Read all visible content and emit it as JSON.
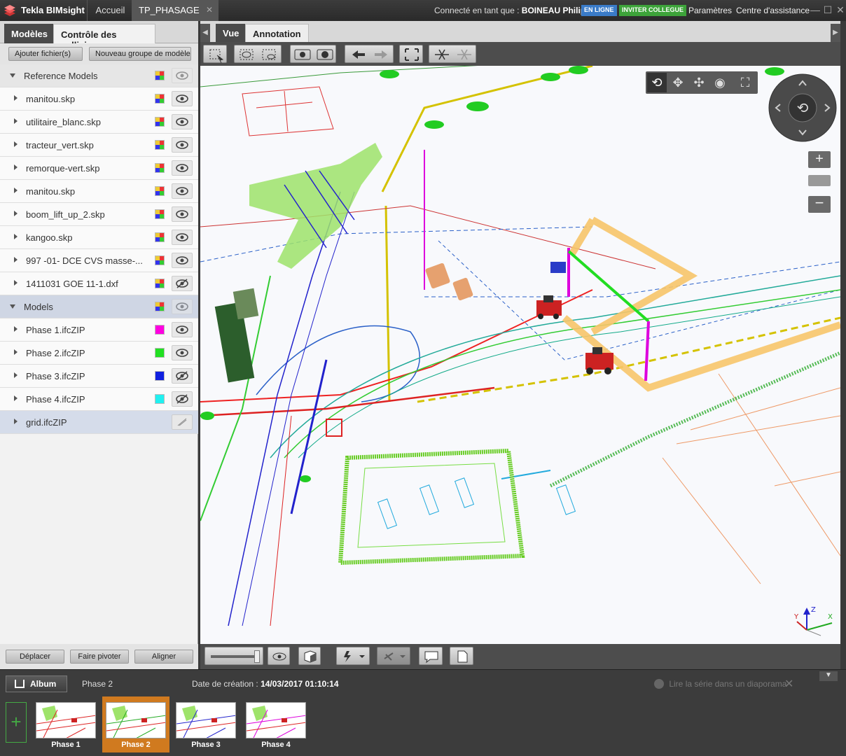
{
  "titlebar": {
    "app_name": "Tekla BIMsight",
    "tab_home": "Accueil",
    "tab_project": "TP_PHASAGE",
    "user_prefix": "Connecté en tant que :",
    "user_name": "BOINEAU Philippe",
    "status_badge": "EN LIGNE",
    "invite_button": "INVITER COLLEGUE",
    "settings_link": "Paramètres",
    "help_link": "Centre d'assistance"
  },
  "left_panel": {
    "tab_models": "Modèles",
    "tab_clashes": "Contrôle des collisions",
    "add_files": "Ajouter fichier(s)",
    "new_group": "Nouveau groupe de modèles",
    "groups": [
      {
        "label": "Reference Models",
        "items": [
          {
            "label": "manitou.skp",
            "color": "multi",
            "visible": true
          },
          {
            "label": "utilitaire_blanc.skp",
            "color": "multi",
            "visible": true
          },
          {
            "label": "tracteur_vert.skp",
            "color": "multi",
            "visible": true
          },
          {
            "label": "remorque-vert.skp",
            "color": "multi",
            "visible": true
          },
          {
            "label": "manitou.skp",
            "color": "multi",
            "visible": true
          },
          {
            "label": "boom_lift_up_2.skp",
            "color": "multi",
            "visible": true
          },
          {
            "label": "kangoo.skp",
            "color": "multi",
            "visible": true
          },
          {
            "label": "997 -01- DCE CVS masse-...",
            "color": "multi",
            "visible": true
          },
          {
            "label": "1411031 GOE 11-1.dxf",
            "color": "multi",
            "visible": false
          }
        ]
      },
      {
        "label": "Models",
        "items": [
          {
            "label": "Phase 1.ifcZIP",
            "color": "#ff00e0",
            "visible": true
          },
          {
            "label": "Phase 2.ifcZIP",
            "color": "#22e022",
            "visible": true
          },
          {
            "label": "Phase 3.ifcZIP",
            "color": "#1020e0",
            "visible": false
          },
          {
            "label": "Phase 4.ifcZIP",
            "color": "#20f0f0",
            "visible": false
          },
          {
            "label": "grid.ifcZIP",
            "color": "none",
            "visible": "grid"
          }
        ]
      }
    ],
    "move_button": "Déplacer",
    "rotate_button": "Faire pivoter",
    "align_button": "Aligner"
  },
  "viewer": {
    "tab_view": "Vue",
    "tab_annotation": "Annotation"
  },
  "album": {
    "button": "Album",
    "current_view": "Phase 2",
    "created_label": "Date de création :",
    "created_value": "14/03/2017 01:10:14",
    "slideshow": "Lire la série dans un diaporama",
    "thumbnails": [
      "Phase 1",
      "Phase 2",
      "Phase 3",
      "Phase 4"
    ],
    "active_index": 1
  }
}
